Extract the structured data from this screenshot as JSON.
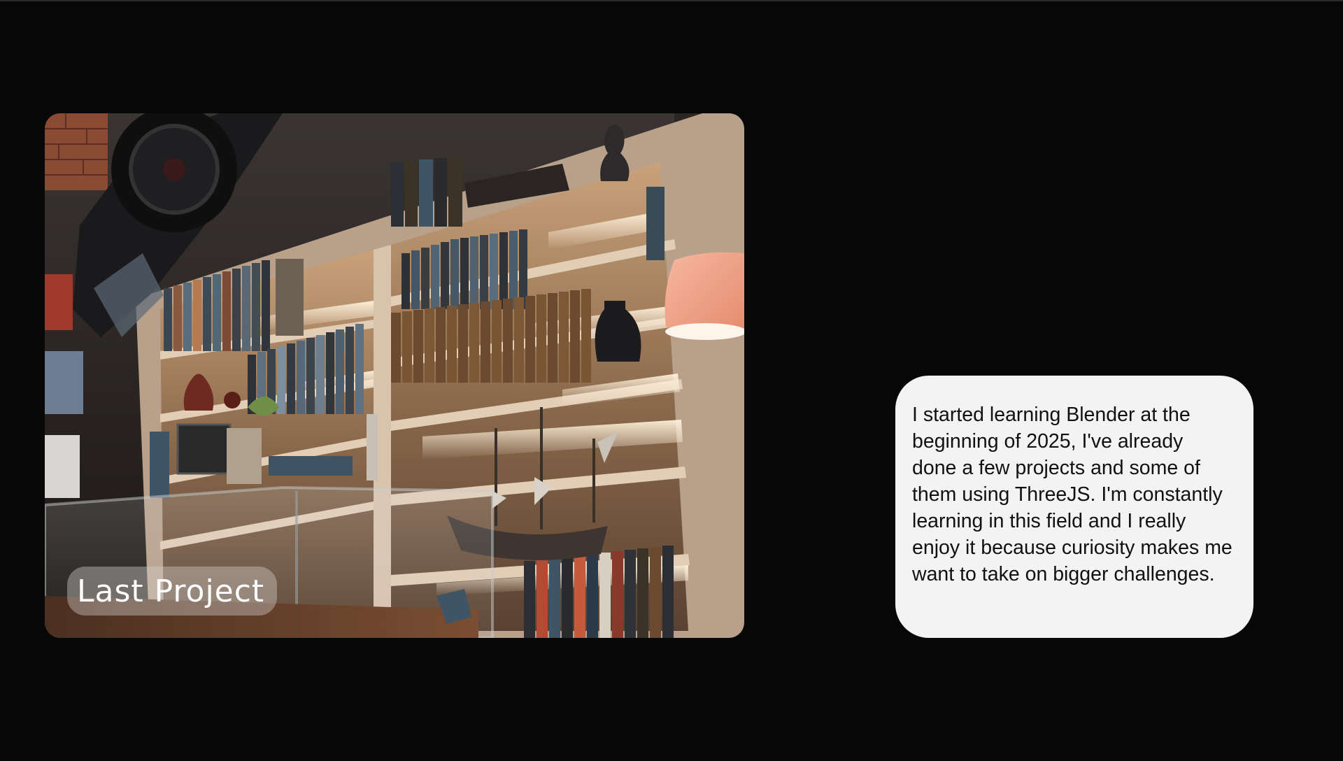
{
  "project_card": {
    "badge_label": "Last Project",
    "image_description_icon": "bookshelf-render-image"
  },
  "about_card": {
    "text": "I started learning Blender at the beginning of 2025, I've already done a few projects and some of them using ThreeJS. I'm constantly learning in this field and I really enjoy it because curiosity makes me want to take on bigger challenges."
  },
  "colors": {
    "background": "#070708",
    "text_card_bg": "#f3f3f3",
    "text_color": "#111111",
    "badge_text": "#ffffff"
  }
}
